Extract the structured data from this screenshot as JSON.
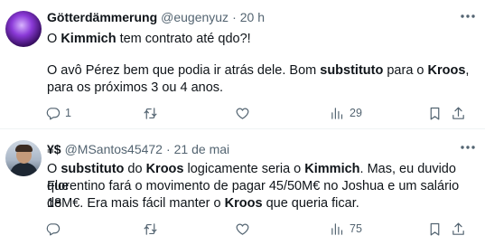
{
  "tweets": [
    {
      "display_name": "Götterdämmerung",
      "handle": "@eugenyuz",
      "separator": "·",
      "time": "20 h",
      "line1": [
        {
          "text": "O ",
          "bold": false
        },
        {
          "text": "Kimmich",
          "bold": true
        },
        {
          "text": " tem contrato até qdo?!",
          "bold": false
        }
      ],
      "line2": [
        {
          "text": "O avô Pérez bem que podia ir atrás dele. Bom ",
          "bold": false
        },
        {
          "text": "substituto",
          "bold": true
        },
        {
          "text": " para o ",
          "bold": false
        },
        {
          "text": "Kroos",
          "bold": true
        },
        {
          "text": ",",
          "bold": false
        }
      ],
      "line3": [
        {
          "text": "para os próximos 3 ou 4 anos.",
          "bold": false
        }
      ],
      "reply_count": "1",
      "retweet_count": "",
      "like_count": "",
      "view_count": "29"
    },
    {
      "display_name": "¥$",
      "handle": "@MSantos45472",
      "separator": "·",
      "time": "21 de mai",
      "line1": [
        {
          "text": "O ",
          "bold": false
        },
        {
          "text": "substituto",
          "bold": true
        },
        {
          "text": " do ",
          "bold": false
        },
        {
          "text": "Kroos",
          "bold": true
        },
        {
          "text": " logicamente seria o ",
          "bold": false
        },
        {
          "text": "Kimmich",
          "bold": true
        },
        {
          "text": ". Mas, eu duvido que",
          "bold": false
        }
      ],
      "line2": [
        {
          "text": "Florentino fará o movimento de pagar 45/50M€ no Joshua e um salário de",
          "bold": false
        }
      ],
      "line3": [
        {
          "text": "18M€. Era mais fácil manter o ",
          "bold": false
        },
        {
          "text": "Kroos",
          "bold": true
        },
        {
          "text": " que queria ficar.",
          "bold": false
        }
      ],
      "reply_count": "",
      "retweet_count": "",
      "like_count": "",
      "view_count": "75"
    }
  ],
  "icons": {
    "more": "more-dots-icon",
    "reply": "reply-icon",
    "retweet": "retweet-icon",
    "like": "like-icon",
    "views": "views-icon",
    "bookmark": "bookmark-icon",
    "share": "share-icon"
  },
  "colors": {
    "text": "#0f1419",
    "secondary": "#536471",
    "separator": "#eff3f4"
  }
}
